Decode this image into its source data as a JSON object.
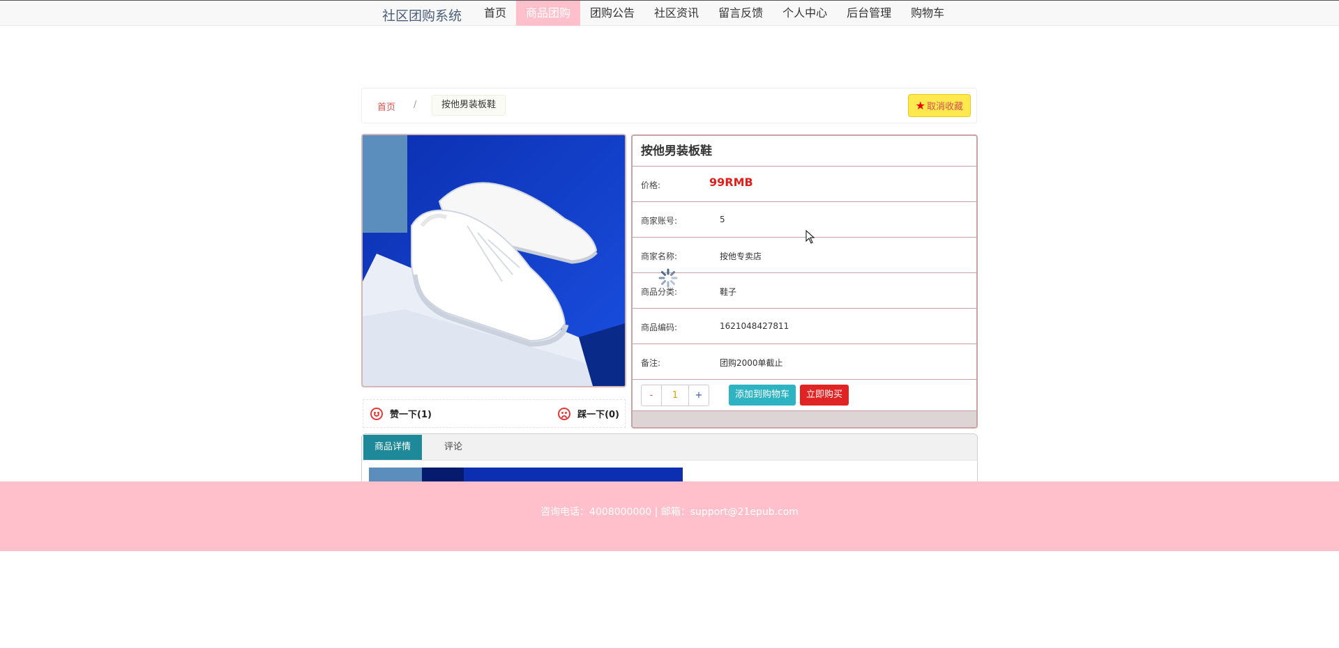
{
  "nav": {
    "brand": "社区团购系统",
    "items": [
      {
        "label": "首页",
        "active": false
      },
      {
        "label": "商品团购",
        "active": true
      },
      {
        "label": "团购公告",
        "active": false
      },
      {
        "label": "社区资讯",
        "active": false
      },
      {
        "label": "留言反馈",
        "active": false
      },
      {
        "label": "个人中心",
        "active": false
      },
      {
        "label": "后台管理",
        "active": false
      },
      {
        "label": "购物车",
        "active": false
      }
    ]
  },
  "breadcrumb": {
    "home": "首页",
    "separator": "/",
    "current": "按他男装板鞋"
  },
  "favorite": {
    "label": "取消收藏",
    "icon": "star-icon"
  },
  "votes": {
    "like_label": "赞一下(1)",
    "dislike_label": "踩一下(0)"
  },
  "product": {
    "title": "按他男装板鞋",
    "rows": [
      {
        "label": "价格:",
        "value": "99RMB"
      },
      {
        "label": "商家账号:",
        "value": "5"
      },
      {
        "label": "商家名称:",
        "value": "按他专卖店"
      },
      {
        "label": "商品分类:",
        "value": "鞋子"
      },
      {
        "label": "商品编码:",
        "value": "1621048427811"
      },
      {
        "label": "备注:",
        "value": "团购2000单截止"
      }
    ],
    "quantity": "1",
    "minus_label": "-",
    "plus_label": "+",
    "add_to_cart_label": "添加到购物车",
    "buy_now_label": "立即购买"
  },
  "tabs": [
    {
      "label": "商品详情",
      "active": true
    },
    {
      "label": "评论",
      "active": false
    }
  ],
  "footer": {
    "text": "咨询电话：4008000000 | 邮箱：support@21epub.com"
  },
  "colors": {
    "nav_active": "#ffc0cb",
    "footer_bg": "#ffc0cb",
    "price": "#e0201b",
    "cart_button": "#2eb3c2",
    "buy_button": "#e02424",
    "tab_active": "#1e8a99",
    "favorite_button": "#ffe94f"
  }
}
